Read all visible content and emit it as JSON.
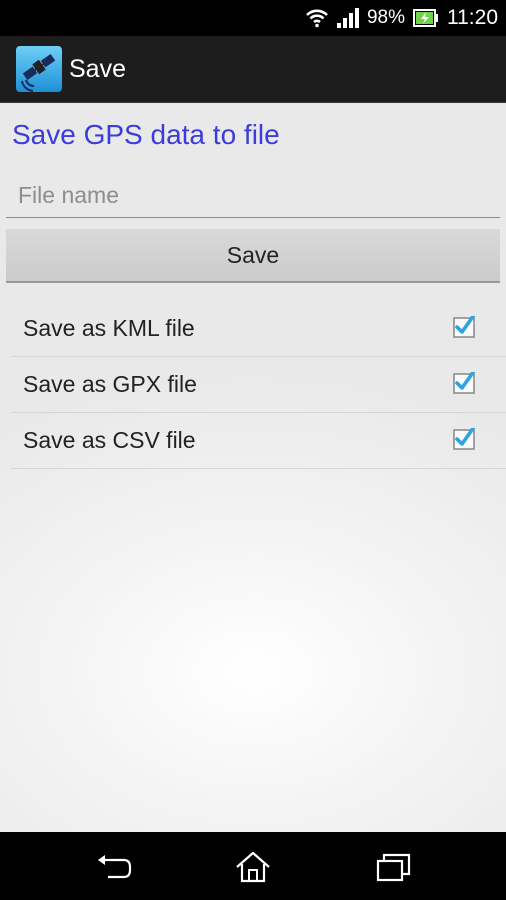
{
  "status_bar": {
    "battery_percent": "98%",
    "time": "11:20",
    "icons": [
      "wifi-icon",
      "signal-icon",
      "battery-charging-icon"
    ]
  },
  "action_bar": {
    "title": "Save",
    "app_icon": "satellite-icon"
  },
  "main": {
    "heading": "Save GPS data to file",
    "filename_input": {
      "placeholder": "File name",
      "value": ""
    },
    "save_button_label": "Save",
    "options": [
      {
        "label": "Save as KML file",
        "checked": true
      },
      {
        "label": "Save as GPX file",
        "checked": true
      },
      {
        "label": "Save as CSV file",
        "checked": true
      }
    ]
  },
  "nav_bar": {
    "buttons": [
      "back-icon",
      "home-icon",
      "recent-apps-icon"
    ]
  },
  "colors": {
    "heading": "#3b3bde",
    "checkbox_check": "#2fa3e0",
    "action_bar_bg": "#1d1d1d"
  }
}
